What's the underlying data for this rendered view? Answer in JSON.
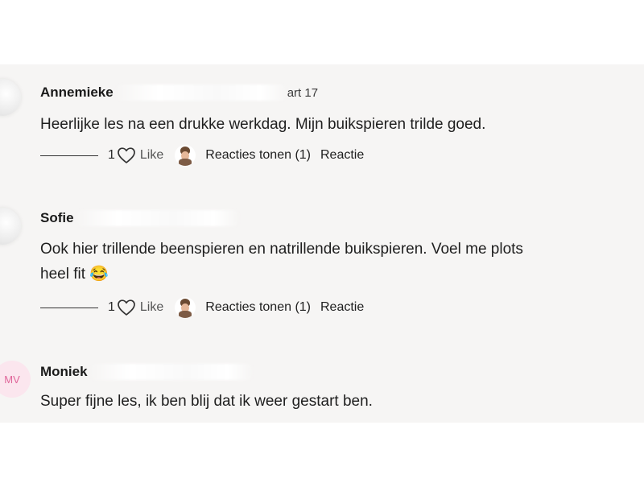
{
  "comments": [
    {
      "name": "Annemieke",
      "date": "art 17",
      "text": "Heerlijke les na een drukke werkdag. Mijn buikspieren trilde goed.",
      "like_count": "1",
      "like_label": "Like",
      "replies_label": "Reacties tonen (1)",
      "reply_label": "Reactie"
    },
    {
      "name": "Sofie",
      "text_line1": "Ook hier trillende beenspieren en natrillende buikspieren. Voel me plots",
      "text_line2": "heel fit",
      "emoji": "😂",
      "like_count": "1",
      "like_label": "Like",
      "replies_label": "Reacties tonen (1)",
      "reply_label": "Reactie"
    },
    {
      "initials": "MV",
      "name": "Moniek",
      "text": "Super fijne les, ik ben blij dat ik weer gestart ben."
    }
  ],
  "icons": {
    "like": "heart-outline-icon"
  },
  "colors": {
    "background": "#f6f5f4",
    "initials_bg": "#fbe6ee",
    "initials_fg": "#e0669a"
  }
}
